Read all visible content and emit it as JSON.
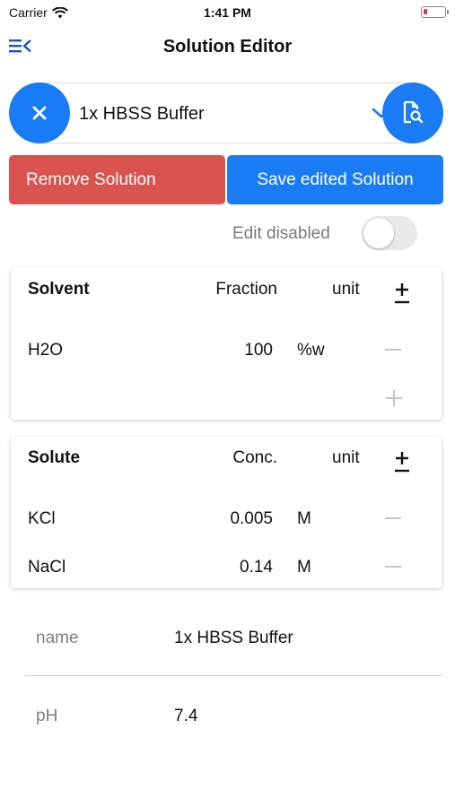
{
  "status_bar": {
    "carrier": "Carrier",
    "time": "1:41 PM",
    "wifi_icon": "wifi-icon",
    "battery_icon": "battery-low-icon",
    "battery_color": "#e0363c"
  },
  "nav": {
    "title": "Solution Editor",
    "menu_icon": "menu-collapse-icon"
  },
  "selector": {
    "selected_solution": "1x HBSS Buffer",
    "clear_icon": "close-icon",
    "dropdown_icon": "chevron-down-icon",
    "search_icon": "document-search-icon"
  },
  "actions": {
    "remove_label": "Remove Solution",
    "save_label": "Save edited Solution"
  },
  "edit_toggle": {
    "label": "Edit disabled",
    "enabled": false
  },
  "solvent_table": {
    "headers": {
      "name": "Solvent",
      "value": "Fraction",
      "unit": "unit",
      "toggle_symbol": "±"
    },
    "rows": [
      {
        "name": "H2O",
        "value": "100",
        "unit": "%w"
      }
    ]
  },
  "solute_table": {
    "headers": {
      "name": "Solute",
      "value": "Conc.",
      "unit": "unit",
      "toggle_symbol": "±"
    },
    "rows": [
      {
        "name": "KCl",
        "value": "0.005",
        "unit": "M"
      },
      {
        "name": "NaCl",
        "value": "0.14",
        "unit": "M"
      }
    ]
  },
  "properties": [
    {
      "label": "name",
      "value": "1x HBSS Buffer"
    },
    {
      "label": "pH",
      "value": "7.4"
    }
  ],
  "colors": {
    "accent": "#1a7cf5",
    "danger": "#d9534f"
  }
}
